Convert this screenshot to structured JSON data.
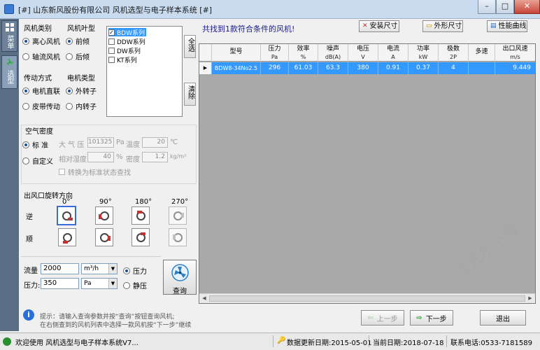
{
  "window": {
    "title": "[#] 山东新风股份有限公司 风机选型与电子样本系统 [#]",
    "min_label": "–",
    "max_label": "□",
    "close_label": "✕"
  },
  "sidebar": {
    "tabs": [
      {
        "label": "菜单"
      },
      {
        "label": "选型"
      }
    ]
  },
  "filters": {
    "fan_type": {
      "title": "风机类别",
      "options": [
        "离心风机",
        "轴流风机"
      ],
      "selected": 0
    },
    "blade_type": {
      "title": "风机叶型",
      "options": [
        "前倾",
        "后倾"
      ],
      "selected": 0
    },
    "drive": {
      "title": "传动方式",
      "options": [
        "电机直联",
        "皮带传动"
      ],
      "selected": 0
    },
    "motor": {
      "title": "电机类型",
      "options": [
        "外转子",
        "内转子"
      ],
      "selected": 0
    },
    "series": [
      {
        "label": "BDW系列",
        "checked": true
      },
      {
        "label": "DDW系列",
        "checked": false
      },
      {
        "label": "DW系列",
        "checked": false
      },
      {
        "label": "KT系列",
        "checked": false
      }
    ],
    "select_all": "全选",
    "clear": "清除"
  },
  "air_density": {
    "title": "空气密度",
    "standard_label": "标  准",
    "custom_label": "自定义",
    "pressure_label": "大 气 压",
    "pressure_value": "101325",
    "pressure_unit": "Pa",
    "temp_label": "温度",
    "temp_value": "20",
    "temp_unit": "℃",
    "humidity_label": "相对湿度",
    "humidity_value": "40",
    "humidity_unit": "%",
    "density_label": "密度",
    "density_value": "1.2",
    "density_unit": "kg/m³",
    "convert_label": "转换为标准状态查找"
  },
  "outlet": {
    "title": "出风口旋转方向",
    "angles": [
      "0°",
      "90°",
      "180°",
      "270°"
    ],
    "rows": [
      "逆",
      "顺"
    ]
  },
  "query": {
    "flow_label": "流量",
    "flow_value": "2000",
    "flow_unit": "m³/h",
    "pressure_label": "压力:",
    "pressure_value": "350",
    "pressure_unit": "Pa",
    "total_pressure": "压力",
    "static_pressure": "静压",
    "button": "查询"
  },
  "results": {
    "summary": "共找到1款符合条件的风机!",
    "install_btn": "安装尺寸",
    "outline_btn": "外形尺寸",
    "curve_btn": "性能曲线",
    "columns": [
      {
        "name": "型号",
        "unit": ""
      },
      {
        "name": "压力",
        "unit": "Pa"
      },
      {
        "name": "效率",
        "unit": "%"
      },
      {
        "name": "噪声",
        "unit": "dB(A)"
      },
      {
        "name": "电压",
        "unit": "V"
      },
      {
        "name": "电流",
        "unit": "A"
      },
      {
        "name": "功率",
        "unit": "kW"
      },
      {
        "name": "极数",
        "unit": "2P"
      },
      {
        "name": "多速",
        "unit": ""
      },
      {
        "name": "出口风速",
        "unit": "m/s"
      }
    ],
    "rows": [
      [
        "BDW8-34No2.5",
        "296",
        "61.03",
        "63.3",
        "380",
        "0.91",
        "0.37",
        "4",
        "",
        "9.449"
      ]
    ]
  },
  "hint": {
    "line1": "提示：请输入查询参数并按“查询”按钮查询风机;",
    "line2": "在右侧查到的风机列表中选择一款风机按“下一步”继续"
  },
  "nav": {
    "prev": "上一步",
    "next": "下一步",
    "exit": "退出"
  },
  "status": {
    "welcome": "欢迎使用 风机选型与电子样本系统V7...",
    "data_date": "数据更新日期:2015-05-01",
    "current_date": "当前日期:2018-07-18",
    "contact": "联系电话:0533-7181589"
  },
  "watermark": "当克尔下载"
}
